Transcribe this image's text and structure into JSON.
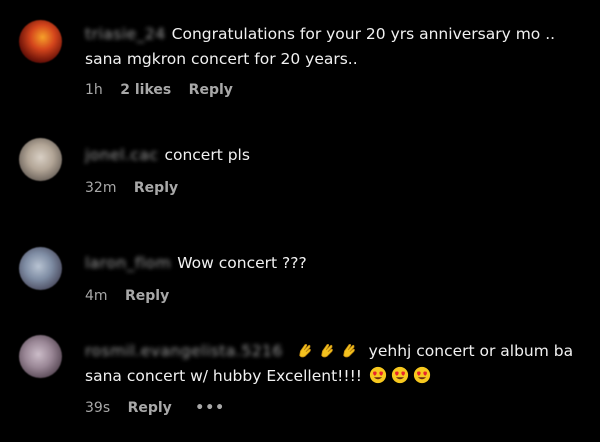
{
  "comments": [
    {
      "username": "triasie_24",
      "text_line1": "Congratulations for your 20 yrs anniversary mo ..",
      "text_line2": "sana mgkron concert for 20 years..",
      "time": "1h",
      "likes": "2 likes",
      "reply": "Reply",
      "avatar_color": "#c9341a"
    },
    {
      "username": "jonel.cac",
      "text_line1": "concert pls",
      "time": "32m",
      "reply": "Reply",
      "avatar_color": "#9a8f86"
    },
    {
      "username": "laron_flom",
      "text_line1": "Wow concert ???",
      "time": "4m",
      "reply": "Reply",
      "avatar_color": "#7e8fa4"
    },
    {
      "username": "rosmil.evangelista.5216",
      "text_line1": "yehhj concert or album ba",
      "text_line2_prefix": "sana concert w/ hubby Excellent!!!!",
      "time": "39s",
      "reply": "Reply",
      "more": "•••",
      "avatar_color": "#8a7a86"
    }
  ]
}
